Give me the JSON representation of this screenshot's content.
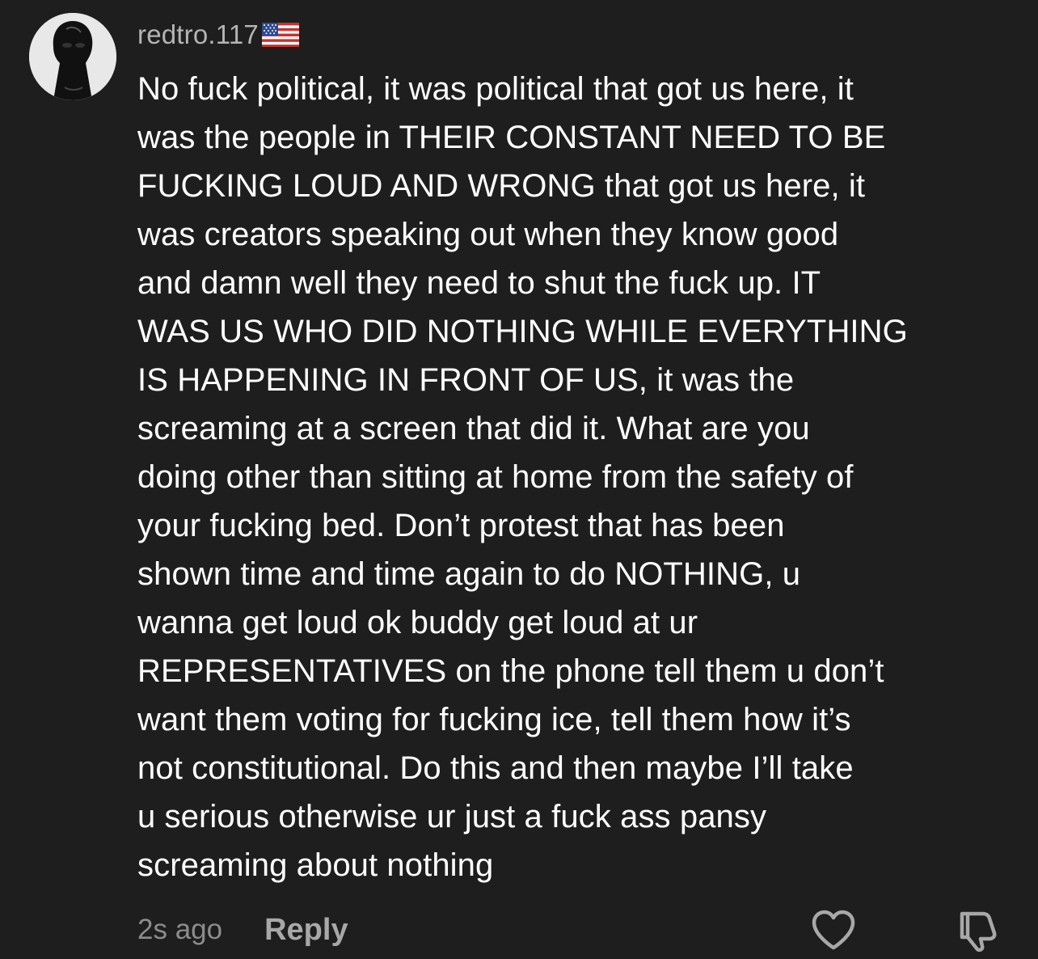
{
  "comment": {
    "username": "redtro.117",
    "flag_icon": "us-flag-icon",
    "text": "No fuck political, it was political that got us here, it\nwas the people in THEIR CONSTANT NEED TO BE\nFUCKING LOUD AND WRONG that got us here, it\nwas creators speaking out when they know good\nand damn well they need to shut the fuck up. IT\nWAS US WHO DID NOTHING WHILE EVERYTHING\nIS HAPPENING IN FRONT OF US, it was the\nscreaming at a screen that did it. What are you\ndoing other than sitting at home from the safety of\nyour fucking bed. Don’t protest that has been\nshown time and time again to do NOTHING, u\nwanna get loud ok buddy get loud at ur\nREPRESENTATIVES on the phone tell them u don’t\nwant them voting for fucking ice, tell them how it’s\nnot constitutional. Do this and then maybe I’ll take\nu serious otherwise ur just a fuck ass pansy\nscreaming about nothing",
    "timestamp": "2s ago",
    "reply_label": "Reply"
  },
  "icons": {
    "like": "heart-icon",
    "dislike": "thumbs-down-icon"
  },
  "colors": {
    "background": "#1e1e1e",
    "text": "#ffffff",
    "username": "#b4b4b4",
    "muted": "#8c8c8c"
  }
}
